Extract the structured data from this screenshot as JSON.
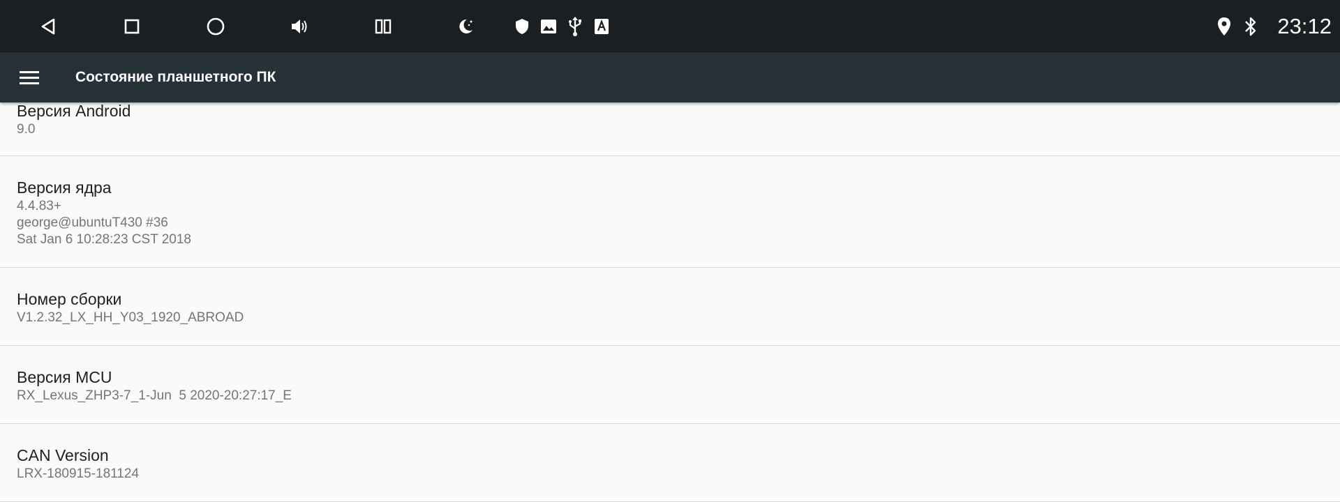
{
  "status_bar": {
    "icons": [
      "back-icon",
      "recents-icon",
      "home-icon",
      "volume-icon",
      "split-screen-icon",
      "night-mode-icon",
      "shield-icon",
      "image-icon",
      "usb-icon",
      "text-a-icon",
      "location-icon",
      "bluetooth-icon"
    ],
    "time": "23:12",
    "colors": {
      "background": "#1c1f21",
      "icon": "#ffffff"
    }
  },
  "app_bar": {
    "title": "Состояние планшетного ПК",
    "menu_icon": "hamburger-menu-icon",
    "colors": {
      "background": "#263238",
      "text": "#ffffff"
    }
  },
  "items": [
    {
      "title": "Версия Android",
      "value": "9.0"
    },
    {
      "title": "Версия ядра",
      "value": "4.4.83+\ngeorge@ubuntuT430 #36\nSat Jan 6 10:28:23 CST 2018"
    },
    {
      "title": "Номер сборки",
      "value": "V1.2.32_LX_HH_Y03_1920_ABROAD"
    },
    {
      "title": "Версия MCU",
      "value": "RX_Lexus_ZHP3-7_1-Jun  5 2020-20:27:17_E"
    },
    {
      "title": "CAN Version",
      "value": "LRX-180915-181124"
    }
  ],
  "colors": {
    "background": "#fafafa",
    "title_text": "#212121",
    "value_text": "#757575",
    "divider": "#d6d6d6"
  }
}
